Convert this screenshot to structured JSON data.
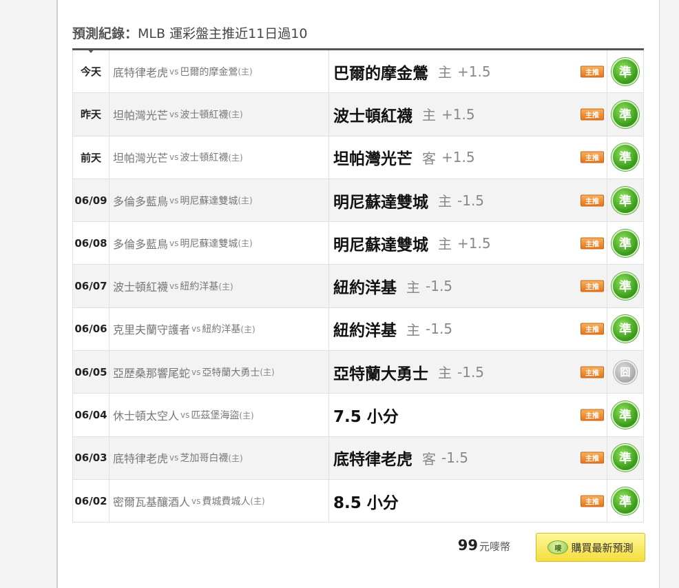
{
  "heading": {
    "label": "預測紀錄",
    "separator": "：",
    "title": "MLB 運彩盤主推近11日過10"
  },
  "vs_text": "vs",
  "home_marker": "(主)",
  "badge_label": "主推",
  "rows": [
    {
      "date": "今天",
      "away": "底特律老虎",
      "home": "巴爾的摩金鶯",
      "pick": "巴爾的摩金鶯",
      "side": "主",
      "line": "+1.5",
      "result": "準",
      "status": "hit"
    },
    {
      "date": "昨天",
      "away": "坦帕灣光芒",
      "home": "波士頓紅襪",
      "pick": "波士頓紅襪",
      "side": "主",
      "line": "+1.5",
      "result": "準",
      "status": "hit"
    },
    {
      "date": "前天",
      "away": "坦帕灣光芒",
      "home": "波士頓紅襪",
      "pick": "坦帕灣光芒",
      "side": "客",
      "line": "+1.5",
      "result": "準",
      "status": "hit"
    },
    {
      "date": "06/09",
      "away": "多倫多藍鳥",
      "home": "明尼蘇達雙城",
      "pick": "明尼蘇達雙城",
      "side": "主",
      "line": "-1.5",
      "result": "準",
      "status": "hit"
    },
    {
      "date": "06/08",
      "away": "多倫多藍鳥",
      "home": "明尼蘇達雙城",
      "pick": "明尼蘇達雙城",
      "side": "主",
      "line": "+1.5",
      "result": "準",
      "status": "hit"
    },
    {
      "date": "06/07",
      "away": "波士頓紅襪",
      "home": "紐約洋基",
      "pick": "紐約洋基",
      "side": "主",
      "line": "-1.5",
      "result": "準",
      "status": "hit"
    },
    {
      "date": "06/06",
      "away": "克里夫蘭守護者",
      "home": "紐約洋基",
      "pick": "紐約洋基",
      "side": "主",
      "line": "-1.5",
      "result": "準",
      "status": "hit"
    },
    {
      "date": "06/05",
      "away": "亞歷桑那響尾蛇",
      "home": "亞特蘭大勇士",
      "pick": "亞特蘭大勇士",
      "side": "主",
      "line": "-1.5",
      "result": "囧",
      "status": "push"
    },
    {
      "date": "06/04",
      "away": "休士頓太空人",
      "home": "匹茲堡海盜",
      "pick": "7.5 小分",
      "side": "",
      "line": "",
      "result": "準",
      "status": "hit"
    },
    {
      "date": "06/03",
      "away": "底特律老虎",
      "home": "芝加哥白襪",
      "pick": "底特律老虎",
      "side": "客",
      "line": "-1.5",
      "result": "準",
      "status": "hit"
    },
    {
      "date": "06/02",
      "away": "密爾瓦基釀酒人",
      "home": "費城費城人",
      "pick": "8.5 小分",
      "side": "",
      "line": "",
      "result": "準",
      "status": "hit"
    }
  ],
  "purchase": {
    "price": "99",
    "unit": "元嘜幣",
    "coin_label": "嘜",
    "button_label": "購買最新預測"
  },
  "colors": {
    "hit": "#3c9e1c",
    "push": "#a9a9a9",
    "badge": "#e5761c",
    "button": "#f4dd3c"
  }
}
